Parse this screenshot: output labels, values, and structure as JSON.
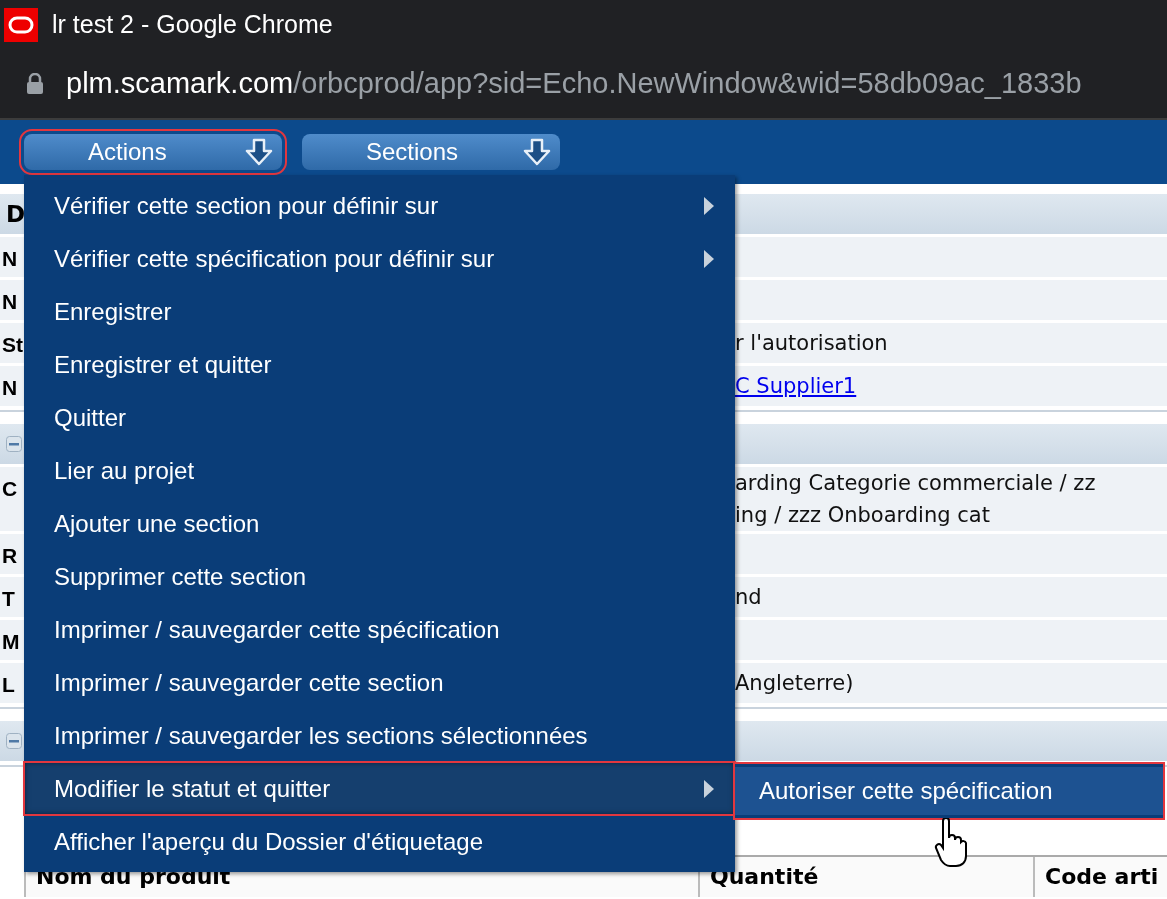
{
  "window": {
    "title": "lr test 2 - Google Chrome"
  },
  "address_bar": {
    "host": "plm.scamark.com",
    "path": "/orbcprod/app?sid=Echo.NewWindow&wid=58db09ac_1833b"
  },
  "toolbar": [
    {
      "label": "Actions",
      "selected": true
    },
    {
      "label": "Sections",
      "selected": false
    }
  ],
  "sections": [
    {
      "title": "D",
      "collapsible": false,
      "rows": [
        {
          "label": "N"
        },
        {
          "label": "N"
        },
        {
          "label": "St",
          "lines": [
            "r l'autorisation"
          ]
        },
        {
          "label": "N",
          "lines": [
            "C Supplier1"
          ],
          "kind": "link"
        }
      ]
    },
    {
      "collapsible": true,
      "rows": [
        {
          "label": "C",
          "lines": [
            "arding Categorie commerciale / zz",
            "ing / zzz Onboarding cat"
          ]
        },
        {
          "label": "R"
        },
        {
          "label": "T",
          "lines": [
            "nd"
          ]
        },
        {
          "label": "M"
        },
        {
          "label": "L",
          "lines": [
            "Angleterre)"
          ]
        }
      ]
    },
    {
      "collapsible": true
    }
  ],
  "table": {
    "columns": [
      "Nom du produit",
      "Quantité",
      "Code arti"
    ]
  },
  "menu": {
    "items": [
      {
        "label": "Vérifier cette section pour définir sur",
        "has_submenu": true,
        "selected": false
      },
      {
        "label": "Vérifier cette spécification pour définir sur",
        "has_submenu": true,
        "selected": false
      },
      {
        "label": "Enregistrer",
        "has_submenu": false,
        "selected": false
      },
      {
        "label": "Enregistrer et quitter",
        "has_submenu": false,
        "selected": false
      },
      {
        "label": "Quitter",
        "has_submenu": false,
        "selected": false
      },
      {
        "label": "Lier au projet",
        "has_submenu": false,
        "selected": false
      },
      {
        "label": "Ajouter une section",
        "has_submenu": false,
        "selected": false
      },
      {
        "label": "Supprimer cette section",
        "has_submenu": false,
        "selected": false
      },
      {
        "label": "Imprimer / sauvegarder cette spécification",
        "has_submenu": false,
        "selected": false
      },
      {
        "label": "Imprimer / sauvegarder cette section",
        "has_submenu": false,
        "selected": false
      },
      {
        "label": "Imprimer / sauvegarder les sections sélectionnées",
        "has_submenu": false,
        "selected": false
      },
      {
        "label": "Modifier le statut et quitter",
        "has_submenu": true,
        "selected": true
      },
      {
        "label": "Afficher l'aperçu du Dossier d'étiquetage",
        "has_submenu": false,
        "selected": false
      }
    ],
    "submenu": [
      {
        "label": "Autoriser cette spécification",
        "selected": true
      }
    ]
  }
}
